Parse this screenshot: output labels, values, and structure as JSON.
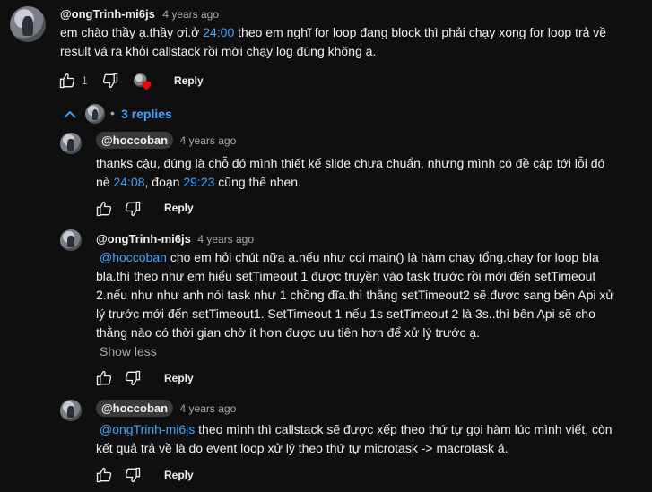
{
  "comment": {
    "author": "@ongTrinh-mi6js",
    "time": "4 years ago",
    "text_1": "em chào thầy ạ.thầy ơi.ở ",
    "timestamp": "24:00",
    "text_2": " theo em nghĩ for loop đang block thì phải chạy xong for loop trả về",
    "text_3": "result và ra khỏi callstack  rồi mới chạy log  đúng không ạ.",
    "like_count": "1",
    "reply_label": "Reply"
  },
  "replies_toggle": {
    "label": "3 replies"
  },
  "replies": [
    {
      "author": "@hoccoban",
      "time": "4 years ago",
      "line1": "thanks cậu, đúng là chỗ đó mình thiết kế slide chưa chuẩn, nhưng mình có đề cập tới lỗi đó",
      "line2_prefix": "nè ",
      "ts1": "24:08",
      "line2_mid": ", đoạn ",
      "ts2": "29:23",
      "line2_suffix": " cũng thế nhen.",
      "reply_label": "Reply"
    },
    {
      "author": "@ongTrinh-mi6js",
      "time": "4 years ago",
      "mention": "@hoccoban",
      "line1": " cho em hỏi chút nữa ạ.nếu như coi main() là hàm chạy tổng.chạy for loop bla",
      "line2": "bla.thì theo như em hiểu setTimeout 1 được truyền vào task trước rồi mới đến setTimeout",
      "line3": "2.nếu như như anh nói task như 1 chồng đĩa.thì thằng setTimeout2 sẽ được sang bên Api xử",
      "line4": "lý trước mới đến setTimeout1. SetTimeout 1 nếu 1s setTimeout 2 là 3s..thì bên Api sẽ cho",
      "line5": "thằng nào có thời gian chờ ít hơn được ưu tiên hơn để xử lý trước ạ.",
      "show_less": "Show less",
      "reply_label": "Reply"
    },
    {
      "author": "@hoccoban",
      "time": "4 years ago",
      "mention": "@ongTrinh-mi6js",
      "line1": "  theo mình thì callstack sẽ được xếp theo thứ tự gọi hàm lúc mình viết, còn",
      "line2": "kết quả trả về là do event loop xử lý theo thứ tự microtask -> macrotask á.",
      "reply_label": "Reply"
    }
  ],
  "colors": {
    "background": "#0f0f0f",
    "link": "#3ea6ff",
    "muted": "#aaaaaa",
    "heart": "#ff0000"
  },
  "icons": [
    "thumbs-up-icon",
    "thumbs-down-icon",
    "creator-heart-icon",
    "chevron-up-icon",
    "avatar"
  ]
}
